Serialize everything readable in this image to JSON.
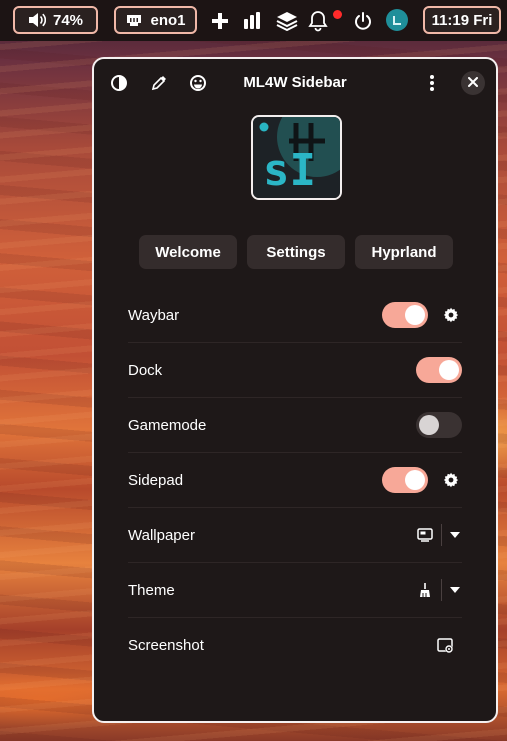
{
  "topbar": {
    "volume": {
      "icon": "volume-icon",
      "label": "74%"
    },
    "network": {
      "icon": "ethernet-icon",
      "label": "eno1"
    },
    "icons": [
      "plus-icon",
      "bar-chart-icon",
      "layers-icon",
      "bell-icon",
      "power-icon",
      "user-avatar-icon"
    ],
    "clock": "11:19 Fri",
    "notification_dot_color": "#ff2a2a"
  },
  "window": {
    "title": "ML4W Sidebar",
    "header_icons": [
      "contrast-icon",
      "eyedropper-icon",
      "smiley-icon",
      "more-vertical-icon",
      "close-icon"
    ],
    "logo_text": "sI",
    "tabs": [
      "Welcome",
      "Settings",
      "Hyprland"
    ],
    "rows": [
      {
        "label": "Waybar",
        "toggle": true,
        "settings": true
      },
      {
        "label": "Dock",
        "toggle": true
      },
      {
        "label": "Gamemode",
        "toggle": false
      },
      {
        "label": "Sidepad",
        "toggle": true,
        "settings": true
      },
      {
        "label": "Wallpaper",
        "icon": "wallpaper-icon",
        "dropdown": true
      },
      {
        "label": "Theme",
        "icon": "brush-icon",
        "dropdown": true
      },
      {
        "label": "Screenshot",
        "icon": "screenshot-icon"
      }
    ]
  },
  "colors": {
    "accent": "#f7a898",
    "window_bg": "#1e1818",
    "border": "#f5f0f0",
    "topbar_bg": "#1c1414"
  }
}
